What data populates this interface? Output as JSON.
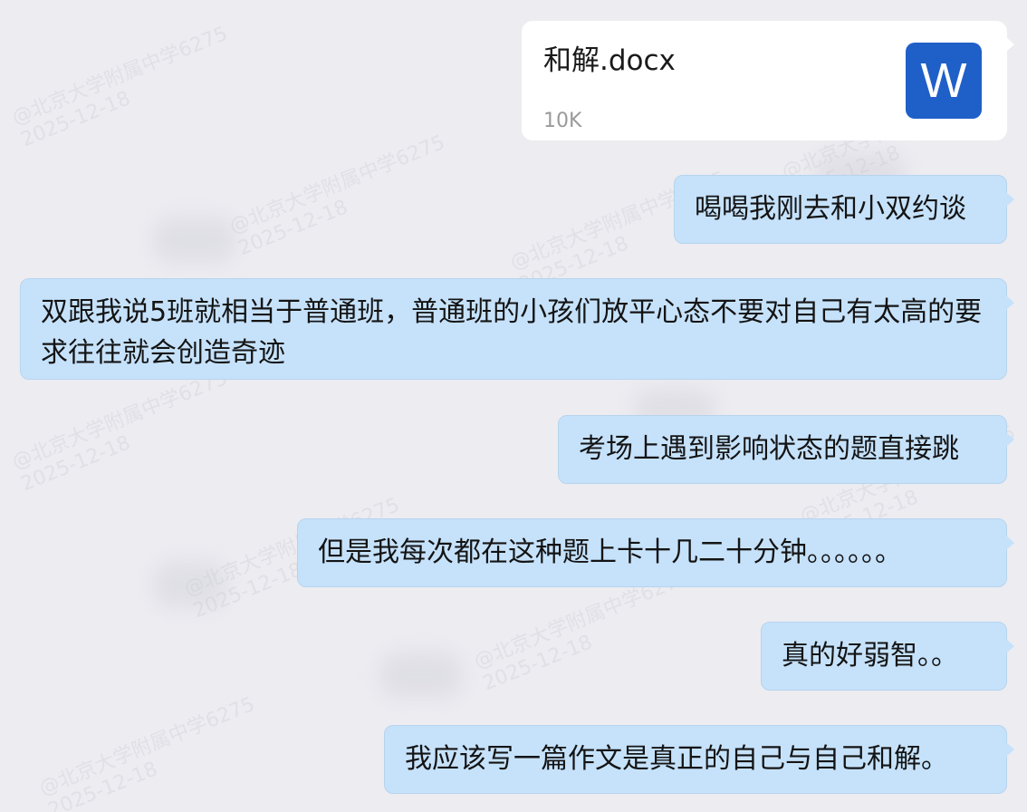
{
  "watermark": {
    "line1": "@北京大学附属中学6275",
    "line2": "2025-12-18"
  },
  "file_message": {
    "file_name": "和解.docx",
    "file_size": "10K",
    "icon_letter": "W",
    "icon_color": "#1f5fc8",
    "icon": "word-document-icon"
  },
  "messages": [
    {
      "text": "喝喝我刚去和小双约谈"
    },
    {
      "text": "双跟我说5班就相当于普通班，普通班的小孩们放平心态不要对自己有太高的要求往往就会创造奇迹"
    },
    {
      "text": "考场上遇到影响状态的题直接跳"
    },
    {
      "text": "但是我每次都在这种题上卡十几二十分钟。。。。。。"
    },
    {
      "text": "真的好弱智。。"
    },
    {
      "text": "我应该写一篇作文是真正的自己与自己和解。"
    }
  ],
  "colors": {
    "background": "#ececf1",
    "bubble": "#c6e2fb",
    "file_card": "#ffffff"
  }
}
